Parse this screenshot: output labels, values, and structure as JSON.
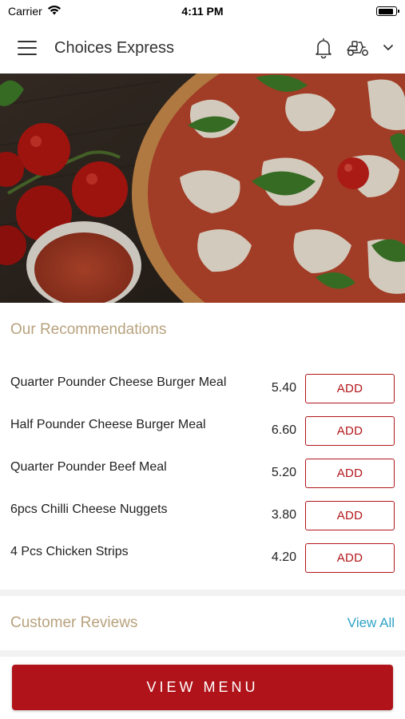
{
  "status_bar": {
    "carrier": "Carrier",
    "time": "4:11 PM",
    "battery_level": 0.9
  },
  "header": {
    "title": "Choices Express",
    "menu_icon": "hamburger-menu-icon",
    "notification_icon": "bell-icon",
    "delivery_icon": "scooter-icon",
    "dropdown_icon": "chevron-down-icon"
  },
  "hero": {
    "image": "pizza-with-tomatoes-photo"
  },
  "recommendations": {
    "title": "Our Recommendations",
    "items": [
      {
        "name": "Quarter Pounder Cheese Burger Meal",
        "price": "5.40",
        "action": "ADD"
      },
      {
        "name": "Half Pounder Cheese Burger Meal",
        "price": "6.60",
        "action": "ADD"
      },
      {
        "name": "Quarter Pounder Beef Meal",
        "price": "5.20",
        "action": "ADD"
      },
      {
        "name": "6pcs Chilli Cheese Nuggets",
        "price": "3.80",
        "action": "ADD"
      },
      {
        "name": "4 Pcs Chicken Strips",
        "price": "4.20",
        "action": "ADD"
      }
    ]
  },
  "reviews": {
    "title": "Customer Reviews",
    "view_all": "View All"
  },
  "footer": {
    "view_menu": "VIEW MENU"
  },
  "colors": {
    "brand_red": "#b0141a",
    "section_title": "#b8a27d",
    "link_blue": "#2fa3c6"
  }
}
